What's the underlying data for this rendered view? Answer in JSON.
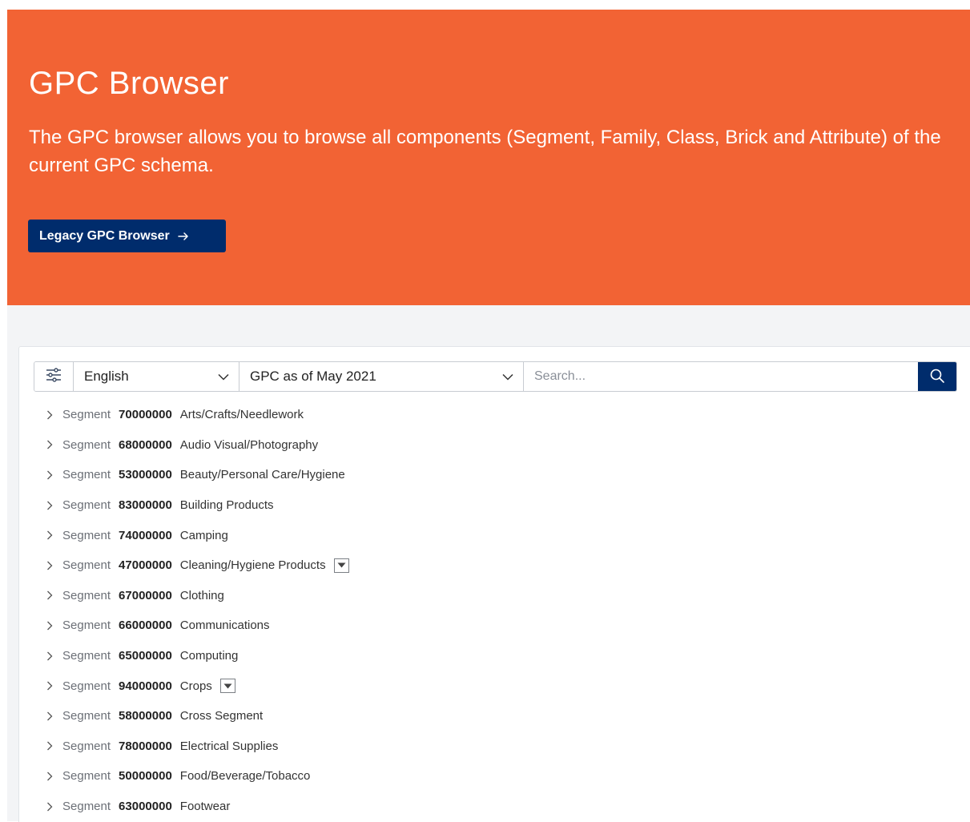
{
  "hero": {
    "title": "GPC Browser",
    "description": "The GPC browser allows you to browse all components (Segment, Family, Class, Brick and Attribute) of the current GPC schema.",
    "legacy_button": "Legacy GPC Browser",
    "background": "#f26334",
    "button_color": "#002c6c"
  },
  "toolbar": {
    "filter_icon": "filter-settings-icon",
    "language": "English",
    "version": "GPC as of May 2021",
    "search_placeholder": "Search...",
    "search_icon": "search-icon"
  },
  "segments": [
    {
      "type": "Segment",
      "code": "70000000",
      "title": "Arts/Crafts/Needlework",
      "dropdown": false
    },
    {
      "type": "Segment",
      "code": "68000000",
      "title": "Audio Visual/Photography",
      "dropdown": false
    },
    {
      "type": "Segment",
      "code": "53000000",
      "title": "Beauty/Personal Care/Hygiene",
      "dropdown": false
    },
    {
      "type": "Segment",
      "code": "83000000",
      "title": "Building Products",
      "dropdown": false
    },
    {
      "type": "Segment",
      "code": "74000000",
      "title": "Camping",
      "dropdown": false
    },
    {
      "type": "Segment",
      "code": "47000000",
      "title": "Cleaning/Hygiene Products",
      "dropdown": true
    },
    {
      "type": "Segment",
      "code": "67000000",
      "title": "Clothing",
      "dropdown": false
    },
    {
      "type": "Segment",
      "code": "66000000",
      "title": "Communications",
      "dropdown": false
    },
    {
      "type": "Segment",
      "code": "65000000",
      "title": "Computing",
      "dropdown": false
    },
    {
      "type": "Segment",
      "code": "94000000",
      "title": "Crops",
      "dropdown": true
    },
    {
      "type": "Segment",
      "code": "58000000",
      "title": "Cross Segment",
      "dropdown": false
    },
    {
      "type": "Segment",
      "code": "78000000",
      "title": "Electrical Supplies",
      "dropdown": false
    },
    {
      "type": "Segment",
      "code": "50000000",
      "title": "Food/Beverage/Tobacco",
      "dropdown": false
    },
    {
      "type": "Segment",
      "code": "63000000",
      "title": "Footwear",
      "dropdown": false
    }
  ]
}
